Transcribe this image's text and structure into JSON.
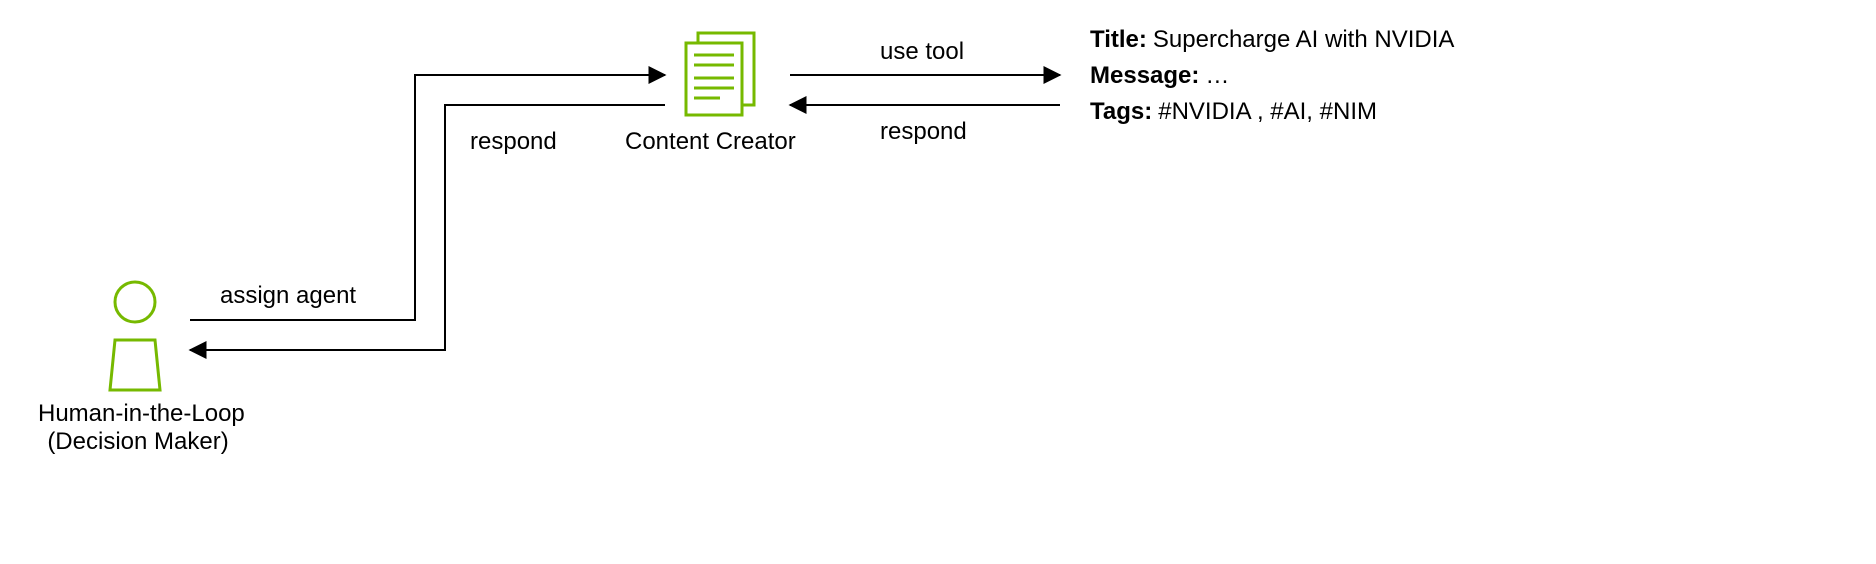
{
  "nodes": {
    "human": {
      "label_line1": "Human-in-the-Loop",
      "label_line2": "(Decision Maker)"
    },
    "content_creator": {
      "label": "Content Creator"
    }
  },
  "edges": {
    "assign_agent": "assign agent",
    "respond_left": "respond",
    "use_tool": "use tool",
    "respond_right": "respond"
  },
  "output": {
    "title_label": "Title:",
    "title_value": "Supercharge AI with NVIDIA",
    "message_label": "Message:",
    "message_value": "…",
    "tags_label": "Tags:",
    "tags_value": "#NVIDIA , #AI, #NIM"
  },
  "colors": {
    "accent": "#76b900",
    "line": "#000000"
  }
}
